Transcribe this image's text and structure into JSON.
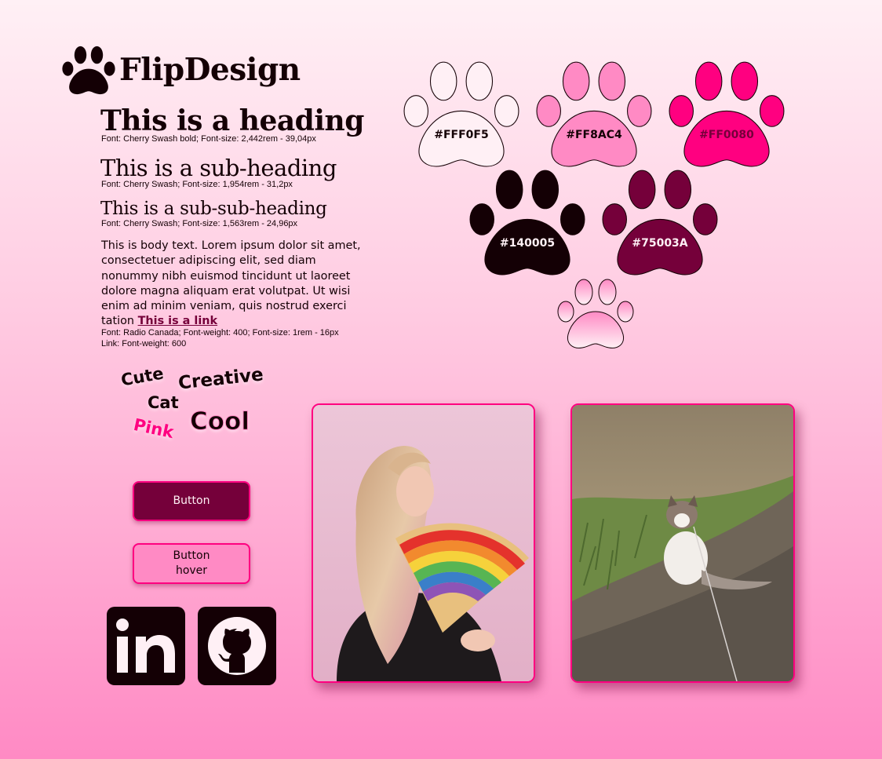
{
  "brand": {
    "name": "FlipDesign",
    "logo_icon": "paw-icon"
  },
  "typography": {
    "heading": "This is a heading",
    "heading_note": "Font: Cherry Swash bold; Font-size: 2,442rem - 39,04px",
    "subheading": "This is a sub-heading",
    "subheading_note": "Font: Cherry Swash; Font-size: 1,954rem - 31,2px",
    "subsubheading": "This is a sub-sub-heading",
    "subsubheading_note": "Font: Cherry Swash; Font-size: 1,563rem - 24,96px",
    "body": "This is body text. Lorem ipsum dolor sit amet, consectetuer adipiscing elit, sed diam nonummy nibh euismod tincidunt ut laoreet dolore magna aliquam erat volutpat. Ut wisi enim ad minim veniam, quis nostrud exerci tation ",
    "link": "This is a link ",
    "body_note": "Font: Radio Canada; Font-weight: 400; Font-size: 1rem - 16px",
    "link_note": "Link: Font-weight: 600"
  },
  "palette": [
    {
      "label": "#FFF0F5",
      "color": "#FFF0F5",
      "text_color": "#140005"
    },
    {
      "label": "#FF8AC4",
      "color": "#FF8AC4",
      "text_color": "#140005"
    },
    {
      "label": "#FF0080",
      "color": "#FF0080",
      "text_color": "#75003A"
    },
    {
      "label": "#140005",
      "color": "#140005",
      "text_color": "#FFF0F5"
    },
    {
      "label": "#75003A",
      "color": "#75003A",
      "text_color": "#FFF0F5"
    }
  ],
  "gradient_paw": {
    "from": "#FF8AC4",
    "to": "#FFF0F5"
  },
  "words": {
    "cute": "Cute",
    "creative": "Creative",
    "cat": "Cat",
    "pink": "Pink",
    "cool": "Cool"
  },
  "buttons": {
    "primary": "Button",
    "hover_line1": "Button",
    "hover_line2": "hover"
  },
  "social": {
    "linkedin": "linkedin-icon",
    "github": "github-icon"
  },
  "photos": {
    "portrait": "portrait-photo",
    "cat": "cat-photo"
  }
}
